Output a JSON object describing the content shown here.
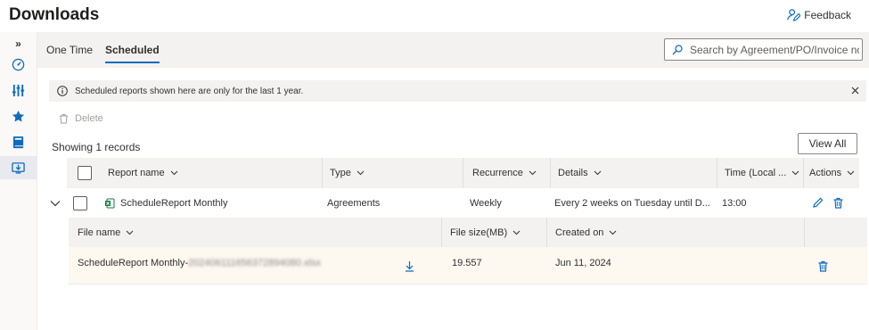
{
  "header": {
    "title": "Downloads",
    "feedback_label": "Feedback"
  },
  "rail": {
    "expand_glyph": "»",
    "items": [
      {
        "icon": "gauge-icon"
      },
      {
        "icon": "sliders-icon"
      },
      {
        "icon": "star-icon"
      },
      {
        "icon": "book-icon"
      },
      {
        "icon": "download-monitor-icon",
        "active": true
      }
    ]
  },
  "tabs": [
    {
      "label": "One Time"
    },
    {
      "label": "Scheduled",
      "active": true
    }
  ],
  "search": {
    "placeholder": "Search by Agreement/PO/Invoice no., ..."
  },
  "banner": {
    "text": "Scheduled reports shown here are only for the last 1 year."
  },
  "toolbar": {
    "delete_label": "Delete"
  },
  "records": {
    "showing_text": "Showing 1 records",
    "view_all_label": "View All"
  },
  "table": {
    "columns": [
      "Report name",
      "Type",
      "Recurrence",
      "Details",
      "Time (Local ...",
      "Actions"
    ],
    "row": {
      "report_name": "ScheduleReport Monthly",
      "type": "Agreements",
      "recurrence": "Weekly",
      "details": "Every 2 weeks on Tuesday until D...",
      "time": "13:00"
    }
  },
  "files": {
    "columns": [
      "File name",
      "File size(MB)",
      "Created on"
    ],
    "row": {
      "file_name_prefix": "ScheduleReport Monthly-",
      "file_name_redacted": "202406111656372894080.xlsx",
      "file_size": "19.557",
      "created_on": "Jun 11, 2024"
    }
  },
  "colors": {
    "accent": "#0f6cbd",
    "excel_green": "#107c41"
  }
}
